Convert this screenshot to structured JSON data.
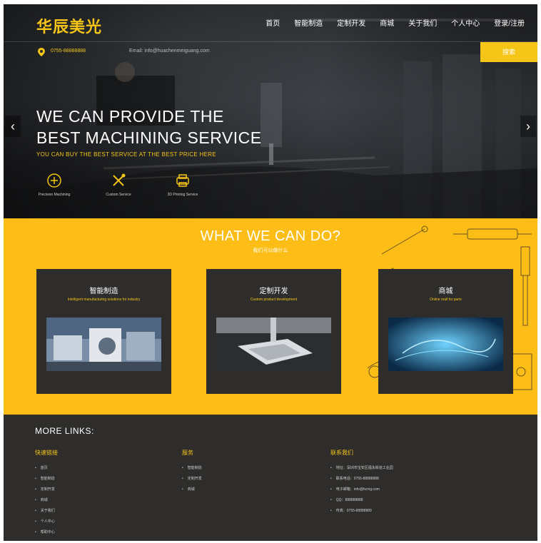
{
  "brand": {
    "logo_text": "华辰美光",
    "accent": "#f5c518",
    "dark": "#2e2d2b"
  },
  "nav": {
    "items": [
      "首页",
      "智能制造",
      "定制开发",
      "商城",
      "关于我们",
      "个人中心",
      "登录/注册"
    ]
  },
  "infobar": {
    "phone": "0755-88888888",
    "email": "Email: info@huachenmeiguang.com",
    "search_label": "搜索"
  },
  "hero": {
    "line1": "WE CAN PROVIDE THE",
    "line2": "BEST MACHINING SERVICE",
    "subtitle": "YOU CAN BUY THE BEST SERVICE AT THE BEST PRICE HERE",
    "features": [
      {
        "icon": "machining-icon",
        "label": "Precision Machining"
      },
      {
        "icon": "tools-icon",
        "label": "Custom Service"
      },
      {
        "icon": "printer-3d-icon",
        "label": "3D Printing Service"
      }
    ]
  },
  "services": {
    "title": "WHAT WE CAN DO?",
    "subtitle": "我们可以做什么",
    "cards": [
      {
        "title": "智能制造",
        "desc": "Intelligent manufacturing solutions for industry"
      },
      {
        "title": "定制开发",
        "desc": "Custom product development"
      },
      {
        "title": "商城",
        "desc": "Online mall for parts"
      }
    ]
  },
  "more": {
    "title": "MORE LINKS:",
    "columns": [
      {
        "title": "快速链接",
        "items": [
          "首页",
          "智能制造",
          "定制开发",
          "商城",
          "关于我们",
          "个人中心",
          "帮助中心"
        ]
      },
      {
        "title": "服务",
        "items": [
          "智能制造",
          "定制开发",
          "商城"
        ]
      },
      {
        "title": "联系我们",
        "items": [
          "地址：深圳市宝安区福永街道工业园",
          "联系电话：0755-88888888",
          "电子邮箱：info@hcmg.com",
          "QQ：888888888",
          "传真：0755-88888889"
        ]
      }
    ]
  }
}
